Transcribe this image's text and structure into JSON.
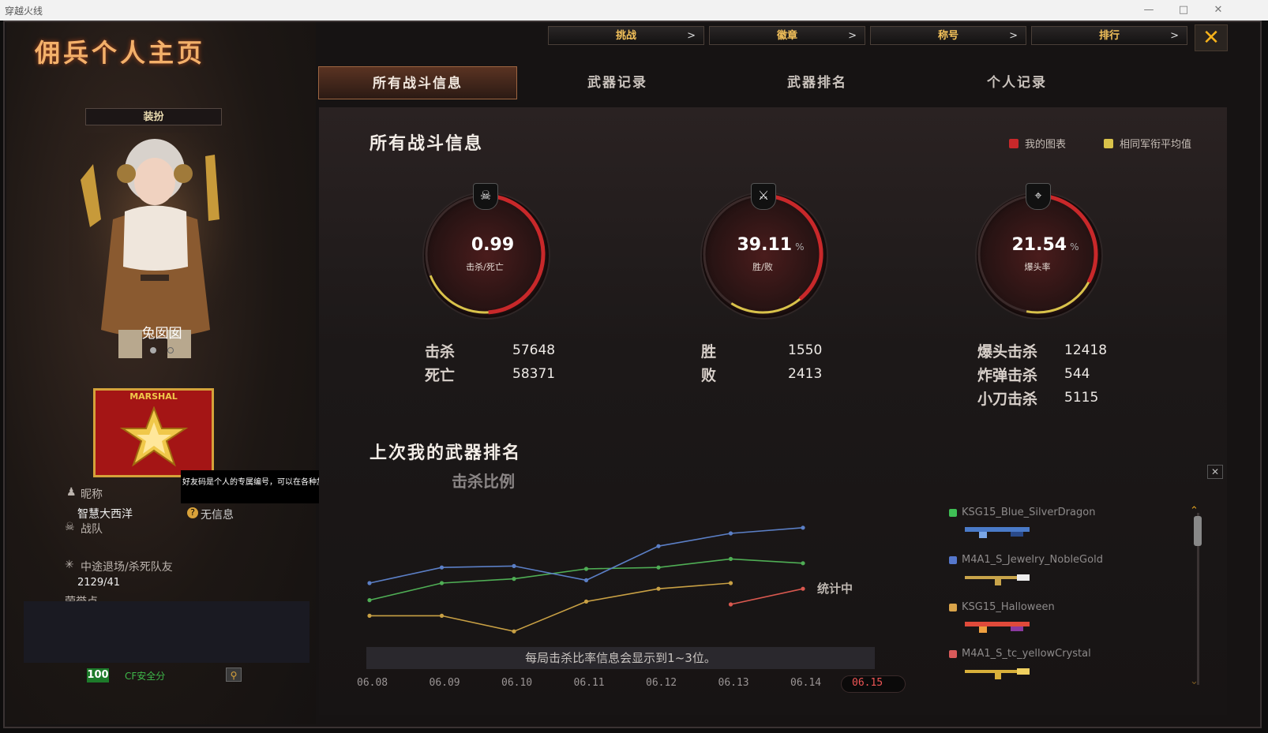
{
  "window": {
    "title": "穿越火线",
    "min": "—",
    "max": "□",
    "close": "✕"
  },
  "page_title": "佣兵个人主页",
  "top_nav": [
    {
      "label": "挑战",
      "arrow": ">"
    },
    {
      "label": "徽章",
      "arrow": ">"
    },
    {
      "label": "称号",
      "arrow": ">"
    },
    {
      "label": "排行",
      "arrow": ">"
    }
  ],
  "close_label": "✕",
  "tabs": [
    "所有战斗信息",
    "武器记录",
    "武器排名",
    "个人记录"
  ],
  "profile": {
    "outfit_button": "装扮",
    "character_name": "兔囡囡",
    "rank_badge": "MARSHAL",
    "tooltip": "好友码是个人的专属编号，可以在各种加好友场景中使用。",
    "nickname_label": "昵称",
    "nickname": "智慧大西洋",
    "info_label": "无信息",
    "clan_label": "战队",
    "quit_label": "中途退场/杀死队友",
    "quit_value": "2129/41",
    "honor_label": "荣誉点",
    "security_score": "100",
    "security_label": "CF安全分"
  },
  "stats": {
    "title": "所有战斗信息",
    "legend": [
      {
        "label": "我的图表",
        "color": "#c8282a"
      },
      {
        "label": "相同军衔平均值",
        "color": "#d9c24a"
      }
    ],
    "rings": [
      {
        "value": "0.99",
        "unit": "",
        "label": "击杀/死亡",
        "value_color": "#ffffff",
        "fill": 0.49
      },
      {
        "value": "39.11",
        "unit": "%",
        "label": "胜/败",
        "value_color": "#ffffff",
        "fill": 0.39
      },
      {
        "value": "21.54",
        "unit": "%",
        "label": "爆头率",
        "value_color": "#ffffff",
        "fill": 0.33
      }
    ],
    "details": [
      [
        {
          "label": "击杀",
          "value": "57648"
        },
        {
          "label": "死亡",
          "value": "58371"
        }
      ],
      [
        {
          "label": "胜",
          "value": "1550"
        },
        {
          "label": "败",
          "value": "2413"
        }
      ],
      [
        {
          "label": "爆头击杀",
          "value": "12418"
        },
        {
          "label": "炸弹击杀",
          "value": "544"
        },
        {
          "label": "小刀击杀",
          "value": "5115"
        }
      ]
    ]
  },
  "weapon_rank": {
    "title": "上次我的武器排名",
    "subtitle": "击杀比例",
    "status": "统计中",
    "footer": "每局击杀比率信息会显示到1~3位。",
    "close": "✕",
    "weapons": [
      {
        "name": "KSG15_Blue_SilverDragon",
        "color": "#3fbf55"
      },
      {
        "name": "M4A1_S_Jewelry_NobleGold",
        "color": "#5577cc"
      },
      {
        "name": "KSG15_Halloween",
        "color": "#d9a44a"
      },
      {
        "name": "M4A1_S_tc_yellowCrystal",
        "color": "#d95a5a"
      }
    ]
  },
  "chart_data": {
    "type": "line",
    "categories": [
      "06.08",
      "06.09",
      "06.10",
      "06.11",
      "06.12",
      "06.13",
      "06.14",
      "06.15"
    ],
    "selected": "06.15",
    "series": [
      {
        "name": "KSG15_Blue_SilverDragon",
        "color": "#4fae55",
        "values": [
          0.33,
          0.45,
          0.48,
          0.55,
          0.56,
          0.62,
          0.59,
          null
        ]
      },
      {
        "name": "M4A1_S_Jewelry_NobleGold",
        "color": "#5b7fc6",
        "values": [
          0.45,
          0.56,
          0.57,
          0.47,
          0.71,
          0.8,
          0.84,
          null
        ]
      },
      {
        "name": "KSG15_Halloween",
        "color": "#c8a044",
        "values": [
          0.22,
          0.22,
          0.11,
          0.32,
          0.41,
          0.45,
          null,
          null
        ]
      },
      {
        "name": "M4A1_S_tc_yellowCrystal",
        "color": "#d9584f",
        "values": [
          null,
          null,
          null,
          null,
          null,
          0.3,
          0.41,
          null
        ]
      }
    ],
    "ylim": [
      0,
      1
    ]
  }
}
